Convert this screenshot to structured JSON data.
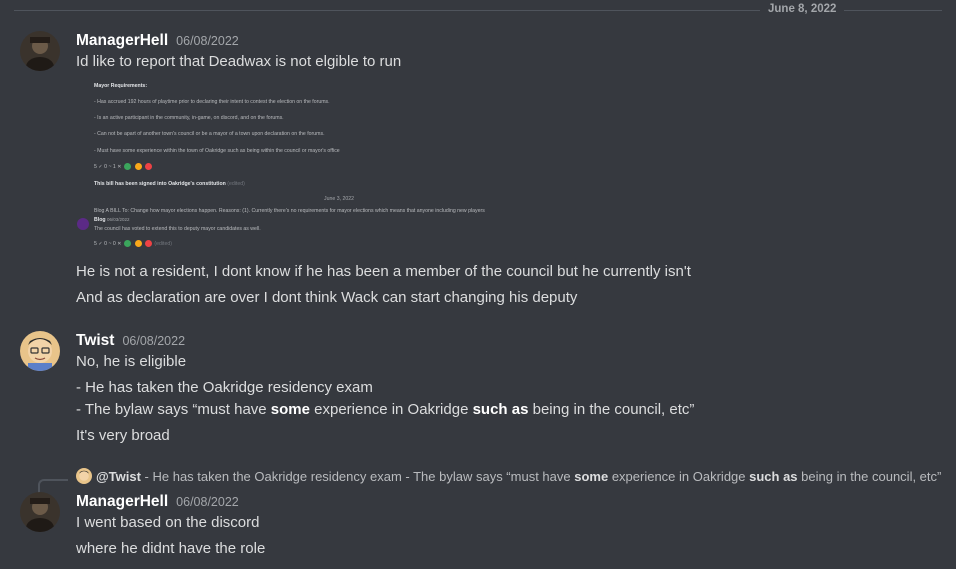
{
  "divider": {
    "date": "June 8, 2022"
  },
  "messages": [
    {
      "author": "ManagerHell",
      "timestamp": "06/08/2022",
      "lines": [
        "Id like to report that Deadwax is not elgible to run",
        "He is not a resident, I dont know if he has been a member of the council but he currently isn't",
        "And as declaration are over I dont think Wack can start changing his deputy"
      ],
      "attachment": {
        "heading": "Mayor Requirements:",
        "items": [
          "- Has accrued 192 hours of playtime prior to declaring their intent to contest the election on the forums.",
          "- Is an active participant in the community, in-game, on discord, and on the forums.",
          "- Can not be apart of another town's council or be a mayor of a town upon declaration on the forums.",
          "- Must have some experience within the town of Oakridge such as being within the council or mayor's office"
        ],
        "vote1": "5 ✓ 0 ~ 1 ✕",
        "signed": "This bill has been signed into Oakridge's constitution",
        "signed_tag": "(edited)",
        "inner_date": "June 3, 2022",
        "inner_reply": "Blog A BILL To: Change how mayor elections happen. Reasons: (1). Currently there's no requirements for mayor elections which means that anyone including new players",
        "inner_author": "Blog",
        "inner_time": "06/03/2022",
        "inner_text": "The council has voted to extend this to deputy mayor candidates as well.",
        "vote2": "5 ✓ 0 ~ 0 ✕",
        "vote2_tag": "(edited)"
      }
    },
    {
      "author": "Twist",
      "timestamp": "06/08/2022",
      "line1": "No, he is eligible",
      "line2": "- He has taken the Oakridge residency exam",
      "line3_a": "- The bylaw says “must have ",
      "line3_b": "some",
      "line3_c": " experience in Oakridge ",
      "line3_d": "such as",
      "line3_e": " being in the council, etc”",
      "line4": "It's very broad"
    },
    {
      "author": "ManagerHell",
      "timestamp": "06/08/2022",
      "reply": {
        "mention": "@Twist",
        "text_a": " - He has taken the Oakridge residency exam - The bylaw says “must have ",
        "text_b": "some",
        "text_c": " experience in Oakridge ",
        "text_d": "such as",
        "text_e": " being in the council, etc”"
      },
      "lines": [
        "I went based on the discord",
        "where he didnt have the role"
      ]
    }
  ],
  "colors": {
    "background": "#36393f",
    "text": "#dcddde",
    "muted": "#a3a6aa",
    "vote_yes": "#3ba55c",
    "vote_abstain": "#faa81a",
    "vote_no": "#ed4245"
  }
}
